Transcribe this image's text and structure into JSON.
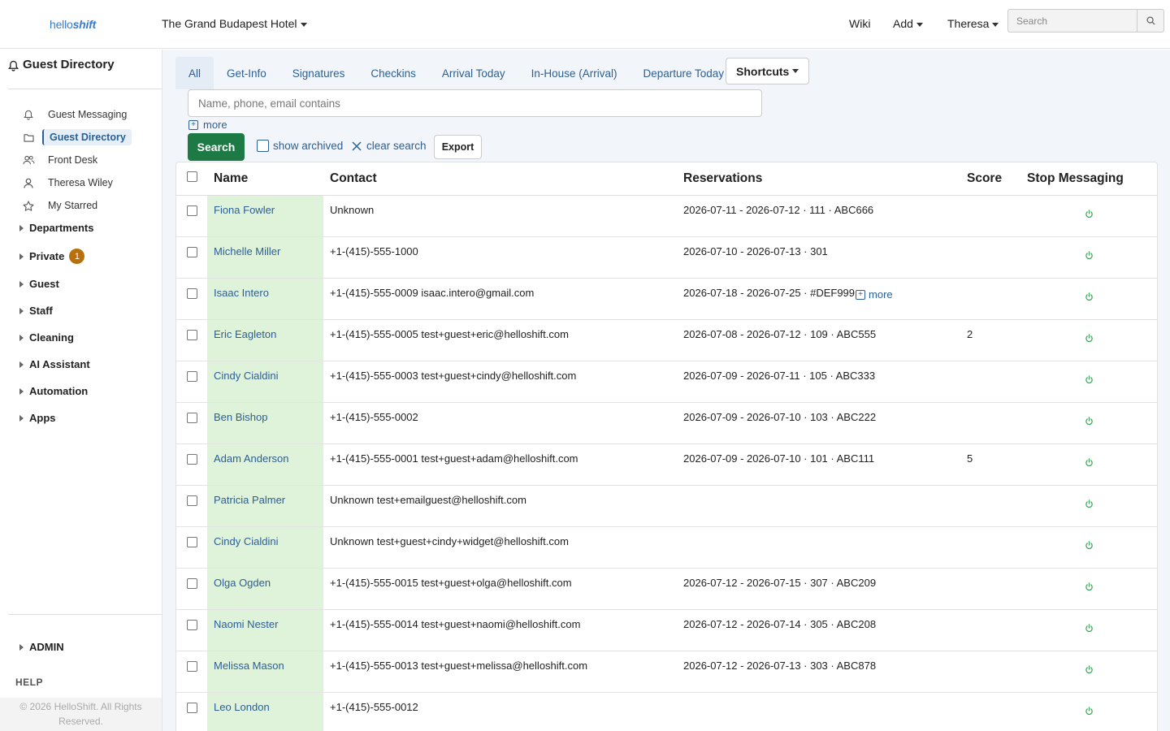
{
  "app": {
    "logo_prefix": "hello",
    "logo_suffix": "shift",
    "hotel": "The Grand Budapest Hotel",
    "nav": {
      "wiki": "Wiki",
      "add": "Add",
      "user": "Theresa"
    },
    "search_placeholder": "Search"
  },
  "sidebar": {
    "title": "Guest Directory",
    "items": [
      {
        "label": "Guest Messaging",
        "icon": "bell-icon"
      },
      {
        "label": "Guest Directory",
        "icon": "folder-icon"
      },
      {
        "label": "Front Desk",
        "icon": "users-icon"
      },
      {
        "label": "Theresa Wiley",
        "icon": "user-icon"
      },
      {
        "label": "My Starred",
        "icon": "star-icon"
      }
    ],
    "groups": [
      "Departments",
      "Private",
      "Guest",
      "Staff",
      "Cleaning",
      "AI Assistant",
      "Automation",
      "Apps"
    ],
    "private_badge": "1",
    "admin": "ADMIN",
    "help": "HELP",
    "footer": "© 2026 HelloShift. All Rights Reserved."
  },
  "tabs": [
    "All",
    "Get-Info",
    "Signatures",
    "Checkins",
    "Arrival Today",
    "In-House (Arrival)",
    "Departure Today"
  ],
  "shortcuts_label": "Shortcuts",
  "filter": {
    "placeholder": "Name, phone, email contains",
    "more": "more",
    "search": "Search",
    "show_archived": "show archived",
    "clear_search": "clear search",
    "export": "Export"
  },
  "table": {
    "columns": [
      "Name",
      "Contact",
      "Reservations",
      "Score",
      "Stop Messaging"
    ],
    "rows": [
      {
        "name": "Fiona Fowler",
        "contact": "Unknown",
        "reservation": "2026-07-11 - 2026-07-12 · 111 · ABC666",
        "score": ""
      },
      {
        "name": "Michelle Miller",
        "contact": "+1-(415)-555-1000",
        "reservation": "2026-07-10 - 2026-07-13 · 301",
        "score": ""
      },
      {
        "name": "Isaac Intero",
        "contact": "+1-(415)-555-0009 isaac.intero@gmail.com",
        "reservation": "2026-07-18 - 2026-07-25 · #DEF999",
        "reservation_more": "more",
        "score": ""
      },
      {
        "name": "Eric Eagleton",
        "contact": "+1-(415)-555-0005 test+guest+eric@helloshift.com",
        "reservation": "2026-07-08 - 2026-07-12 · 109 · ABC555",
        "score": "2"
      },
      {
        "name": "Cindy Cialdini",
        "contact": "+1-(415)-555-0003 test+guest+cindy@helloshift.com",
        "reservation": "2026-07-09 - 2026-07-11 · 105 · ABC333",
        "score": ""
      },
      {
        "name": "Ben Bishop",
        "contact": "+1-(415)-555-0002",
        "reservation": "2026-07-09 - 2026-07-10 · 103 · ABC222",
        "score": ""
      },
      {
        "name": "Adam Anderson",
        "contact": "+1-(415)-555-0001 test+guest+adam@helloshift.com",
        "reservation": "2026-07-09 - 2026-07-10 · 101 · ABC111",
        "score": "5"
      },
      {
        "name": "Patricia Palmer",
        "contact": "Unknown test+emailguest@helloshift.com",
        "reservation": "",
        "score": ""
      },
      {
        "name": "Cindy Cialdini",
        "contact": "Unknown test+guest+cindy+widget@helloshift.com",
        "reservation": "",
        "score": ""
      },
      {
        "name": "Olga Ogden",
        "contact": "+1-(415)-555-0015 test+guest+olga@helloshift.com",
        "reservation": "2026-07-12 - 2026-07-15 · 307 · ABC209",
        "score": ""
      },
      {
        "name": "Naomi Nester",
        "contact": "+1-(415)-555-0014 test+guest+naomi@helloshift.com",
        "reservation": "2026-07-12 - 2026-07-14 · 305 · ABC208",
        "score": ""
      },
      {
        "name": "Melissa Mason",
        "contact": "+1-(415)-555-0013 test+guest+melissa@helloshift.com",
        "reservation": "2026-07-12 - 2026-07-13 · 303 · ABC878",
        "score": ""
      },
      {
        "name": "Leo London",
        "contact": "+1-(415)-555-0012",
        "reservation": "",
        "score": ""
      }
    ]
  },
  "colors": {
    "accent": "#2c5f94",
    "primary_button": "#1e7a45",
    "name_cell_bg": "#dff2da",
    "power_icon": "#3aa85a",
    "badge": "#b8700f"
  }
}
